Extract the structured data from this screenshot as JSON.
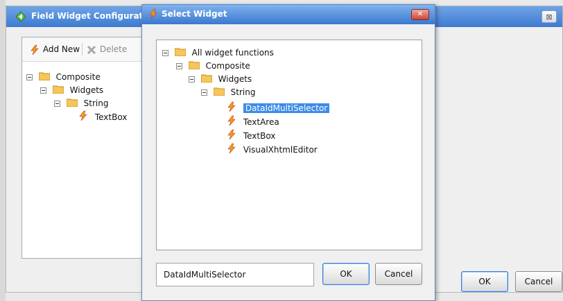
{
  "background_window": {
    "title": "Field Widget Configuration",
    "close_label": "⊠",
    "toolbar": {
      "add_new": "Add New",
      "delete": "Delete"
    },
    "tree": [
      {
        "label": "Composite",
        "level": 0,
        "type": "folder"
      },
      {
        "label": "Widgets",
        "level": 1,
        "type": "folder"
      },
      {
        "label": "String",
        "level": 2,
        "type": "folder"
      },
      {
        "label": "TextBox",
        "level": 3,
        "type": "function"
      }
    ],
    "ok_label": "OK",
    "cancel_label": "Cancel"
  },
  "dialog": {
    "title": "Select Widget",
    "close_label": "✕",
    "tree": [
      {
        "label": "All widget functions",
        "level": 0,
        "type": "folder"
      },
      {
        "label": "Composite",
        "level": 1,
        "type": "folder"
      },
      {
        "label": "Widgets",
        "level": 2,
        "type": "folder"
      },
      {
        "label": "String",
        "level": 3,
        "type": "folder"
      },
      {
        "label": "DataIdMultiSelector",
        "level": 4,
        "type": "function",
        "selected": true
      },
      {
        "label": "TextArea",
        "level": 4,
        "type": "function"
      },
      {
        "label": "TextBox",
        "level": 4,
        "type": "function"
      },
      {
        "label": "VisualXhtmlEditor",
        "level": 4,
        "type": "function"
      }
    ],
    "selected_value": "DataIdMultiSelector",
    "ok_label": "OK",
    "cancel_label": "Cancel"
  },
  "colors": {
    "titlebar": "#3d7bd0",
    "selection": "#3c8ce8",
    "bolt": "#f39c12"
  }
}
